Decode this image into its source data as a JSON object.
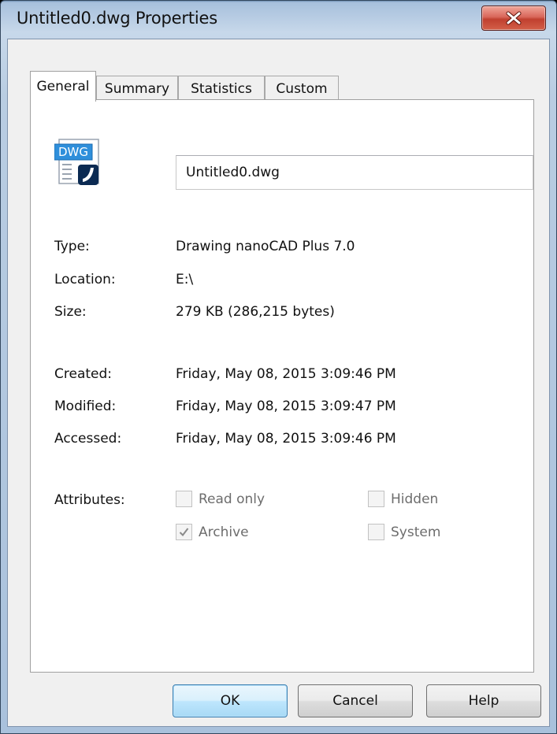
{
  "window": {
    "title": "Untitled0.dwg Properties"
  },
  "tabs": [
    {
      "label": "General"
    },
    {
      "label": "Summary"
    },
    {
      "label": "Statistics"
    },
    {
      "label": "Custom"
    }
  ],
  "general": {
    "icon_label": "DWG",
    "filename": "Untitled0.dwg",
    "fields": {
      "type": {
        "label": "Type:",
        "value": "Drawing nanoCAD Plus 7.0"
      },
      "location": {
        "label": "Location:",
        "value": "E:\\"
      },
      "size": {
        "label": "Size:",
        "value": "279 KB (286,215 bytes)"
      },
      "created": {
        "label": "Created:",
        "value": "Friday, May 08, 2015 3:09:46 PM"
      },
      "modified": {
        "label": "Modified:",
        "value": "Friday, May 08, 2015 3:09:47 PM"
      },
      "accessed": {
        "label": "Accessed:",
        "value": "Friday, May 08, 2015 3:09:46 PM"
      }
    },
    "attributes": {
      "label": "Attributes:",
      "read_only": {
        "label": "Read only",
        "checked": false
      },
      "hidden": {
        "label": "Hidden",
        "checked": false
      },
      "archive": {
        "label": "Archive",
        "checked": true
      },
      "system": {
        "label": "System",
        "checked": false
      }
    }
  },
  "buttons": {
    "ok": "OK",
    "cancel": "Cancel",
    "help": "Help"
  },
  "icons": {
    "close": "close-icon",
    "file": "dwg-file-icon",
    "check": "checkmark-icon"
  }
}
